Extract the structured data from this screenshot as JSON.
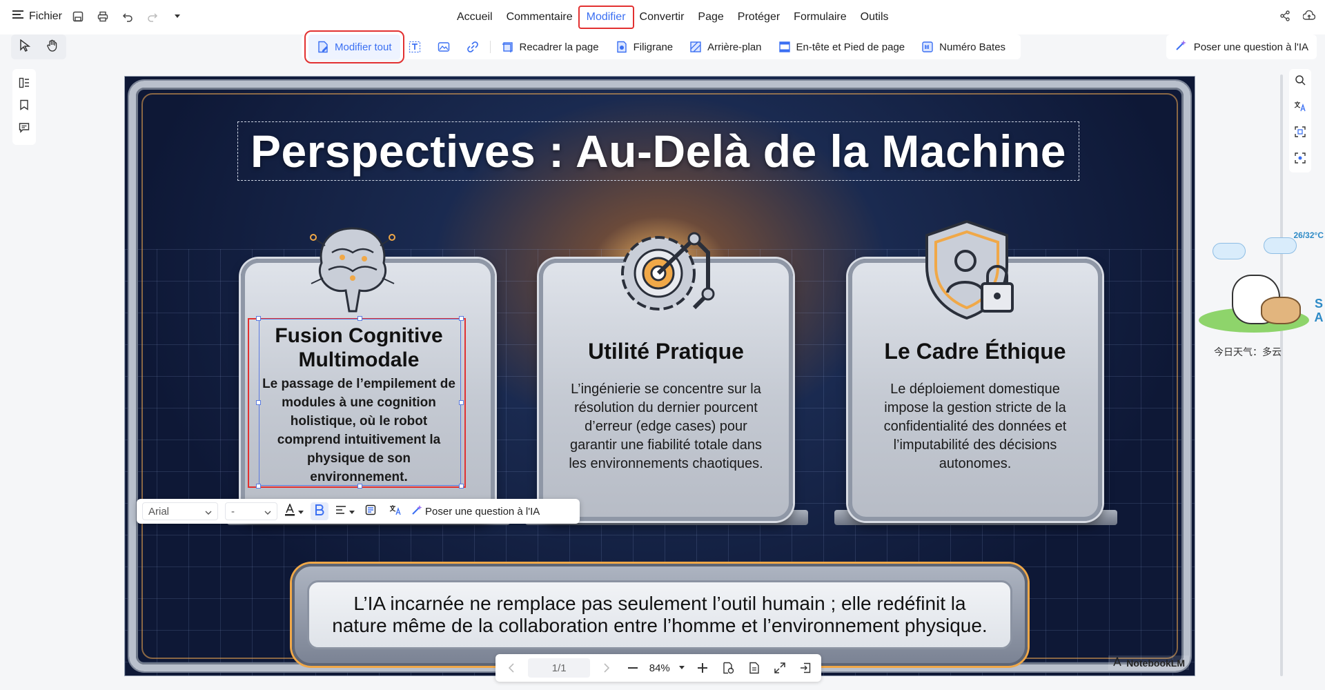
{
  "menu": {
    "file_label": "Fichier",
    "tabs": [
      "Accueil",
      "Commentaire",
      "Modifier",
      "Convertir",
      "Page",
      "Protéger",
      "Formulaire",
      "Outils"
    ],
    "active_tab": "Modifier"
  },
  "ribbon": {
    "edit_all": "Modifier tout",
    "crop_page": "Recadrer la page",
    "watermark": "Filigrane",
    "background": "Arrière-plan",
    "header_footer": "En-tête et Pied de page",
    "bates": "Numéro Bates",
    "ask_ai": "Poser une question à l'IA"
  },
  "slide": {
    "title": "Perspectives : Au-Delà de la Machine",
    "panels": [
      {
        "heading": "Fusion Cognitive Multimodale",
        "body": "Le passage de l’empilement de modules à une cognition holistique, où le robot comprend intuitivement la physique de son environnement."
      },
      {
        "heading": "Utilité Pratique",
        "body": "L’ingénierie se concentre sur la résolution du dernier pourcent d’erreur (edge cases) pour garantir une fiabilité totale dans les environnements chaotiques."
      },
      {
        "heading": "Le Cadre Éthique",
        "body": "Le déploiement domestique impose la gestion stricte de la confidentialité des données et l’imputabilité des décisions autonomes."
      }
    ],
    "banner": "L’IA incarnée ne remplace pas seulement l’outil humain ; elle redéfinit la nature même de la collaboration entre l’homme et l’environnement physique.",
    "watermark": "NotebookLM"
  },
  "text_toolbar": {
    "font": "Arial",
    "size": "-",
    "ask_ai": "Poser une question à l'IA"
  },
  "bottom_nav": {
    "page": "1/1",
    "zoom": "84%"
  },
  "widget": {
    "temp": "26/32°C",
    "weather": "今日天气：多云",
    "side_letters": "S A"
  },
  "colors": {
    "accent": "#3a6ff2",
    "highlight_red": "#e23030",
    "slide_navy": "#0e1836",
    "slide_orange": "#f0a848"
  }
}
